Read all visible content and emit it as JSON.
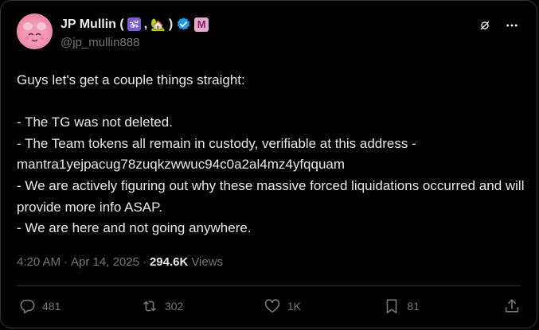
{
  "author": {
    "name": "JP Mullin (",
    "emoji_om": "🕉",
    "sep": ",",
    "emoji_house": "🏡",
    "close": ")",
    "badge_letter": "M",
    "handle": "@jp_mullin888"
  },
  "post": {
    "text": "Guys let's get a couple things straight:\n\n- The TG was not deleted.\n- The Team tokens all remain in custody, verifiable at this address - mantra1yejpacug78zuqkzwwuc94c0a2al4mz4yfqquam\n- We are actively figuring out why these massive forced liquidations occurred and will provide more info ASAP.\n- We are here and not going anywhere."
  },
  "meta": {
    "time": "4:20 AM",
    "dot1": "·",
    "date": "Apr 14, 2025",
    "dot2": "·",
    "views_count": "294.6K",
    "views_label": "Views"
  },
  "actions": {
    "replies": "481",
    "reposts": "302",
    "likes": "1K",
    "bookmarks": "81"
  },
  "colors": {
    "background": "#000000",
    "text": "#e7e9ea",
    "muted": "#71767b",
    "verified": "#1d9bf0",
    "divider": "#2f3336"
  },
  "icons": {
    "grok": "grok-icon",
    "more": "more-icon",
    "reply": "reply-icon",
    "repost": "repost-icon",
    "like": "heart-icon",
    "bookmark": "bookmark-icon",
    "share": "share-icon",
    "verified": "verified-badge-icon"
  }
}
